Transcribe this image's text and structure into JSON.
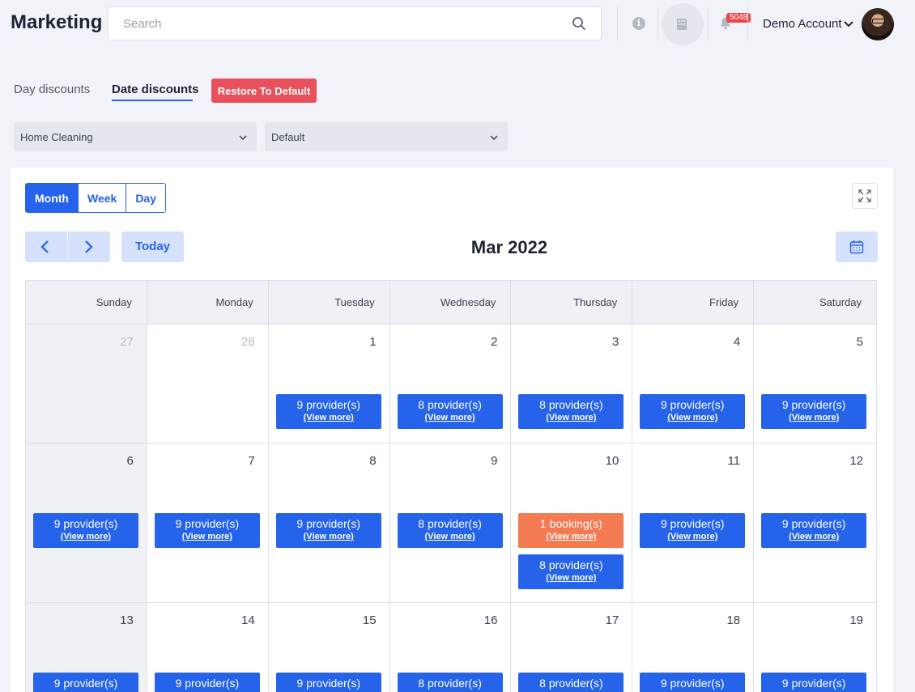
{
  "header": {
    "app_title": "Marketing",
    "search_placeholder": "Search",
    "notification_count": "5048",
    "account_name": "Demo Account"
  },
  "tabs": {
    "day_discounts": "Day discounts",
    "date_discounts": "Date discounts",
    "active": "Date discounts"
  },
  "restore_label": "Restore To Default",
  "filters": {
    "service": "Home Cleaning",
    "variant": "Default"
  },
  "calendar": {
    "views": [
      "Month",
      "Week",
      "Day"
    ],
    "active_view": "Month",
    "today_label": "Today",
    "title": "Mar 2022",
    "weekdays": [
      "Sunday",
      "Monday",
      "Tuesday",
      "Wednesday",
      "Thursday",
      "Friday",
      "Saturday"
    ],
    "view_more": "(View more)",
    "weeks": [
      [
        {
          "day": "27",
          "muted": true,
          "shaded": true,
          "events": []
        },
        {
          "day": "28",
          "muted": true,
          "events": []
        },
        {
          "day": "1",
          "events": [
            {
              "label": "9 provider(s)"
            }
          ]
        },
        {
          "day": "2",
          "events": [
            {
              "label": "8 provider(s)"
            }
          ]
        },
        {
          "day": "3",
          "events": [
            {
              "label": "8 provider(s)"
            }
          ]
        },
        {
          "day": "4",
          "events": [
            {
              "label": "9 provider(s)"
            }
          ]
        },
        {
          "day": "5",
          "events": [
            {
              "label": "9 provider(s)"
            }
          ]
        }
      ],
      [
        {
          "day": "6",
          "shaded": true,
          "events": [
            {
              "label": "9 provider(s)"
            }
          ]
        },
        {
          "day": "7",
          "events": [
            {
              "label": "9 provider(s)"
            }
          ]
        },
        {
          "day": "8",
          "events": [
            {
              "label": "9 provider(s)"
            }
          ]
        },
        {
          "day": "9",
          "events": [
            {
              "label": "8 provider(s)"
            }
          ]
        },
        {
          "day": "10",
          "events": [
            {
              "label": "1 booking(s)",
              "type": "booking"
            },
            {
              "label": "8 provider(s)"
            }
          ]
        },
        {
          "day": "11",
          "events": [
            {
              "label": "9 provider(s)"
            }
          ]
        },
        {
          "day": "12",
          "events": [
            {
              "label": "9 provider(s)"
            }
          ]
        }
      ],
      [
        {
          "day": "13",
          "shaded": true,
          "events": [
            {
              "label": "9 provider(s)"
            }
          ]
        },
        {
          "day": "14",
          "events": [
            {
              "label": "9 provider(s)"
            }
          ]
        },
        {
          "day": "15",
          "events": [
            {
              "label": "9 provider(s)"
            }
          ]
        },
        {
          "day": "16",
          "events": [
            {
              "label": "8 provider(s)"
            }
          ]
        },
        {
          "day": "17",
          "events": [
            {
              "label": "8 provider(s)"
            }
          ]
        },
        {
          "day": "18",
          "events": [
            {
              "label": "9 provider(s)"
            }
          ]
        },
        {
          "day": "19",
          "events": [
            {
              "label": "9 provider(s)"
            }
          ]
        }
      ]
    ]
  },
  "colors": {
    "primary": "#2563eb",
    "booking": "#f47a52",
    "danger": "#e8505b",
    "page_bg": "#f1f3f8"
  }
}
